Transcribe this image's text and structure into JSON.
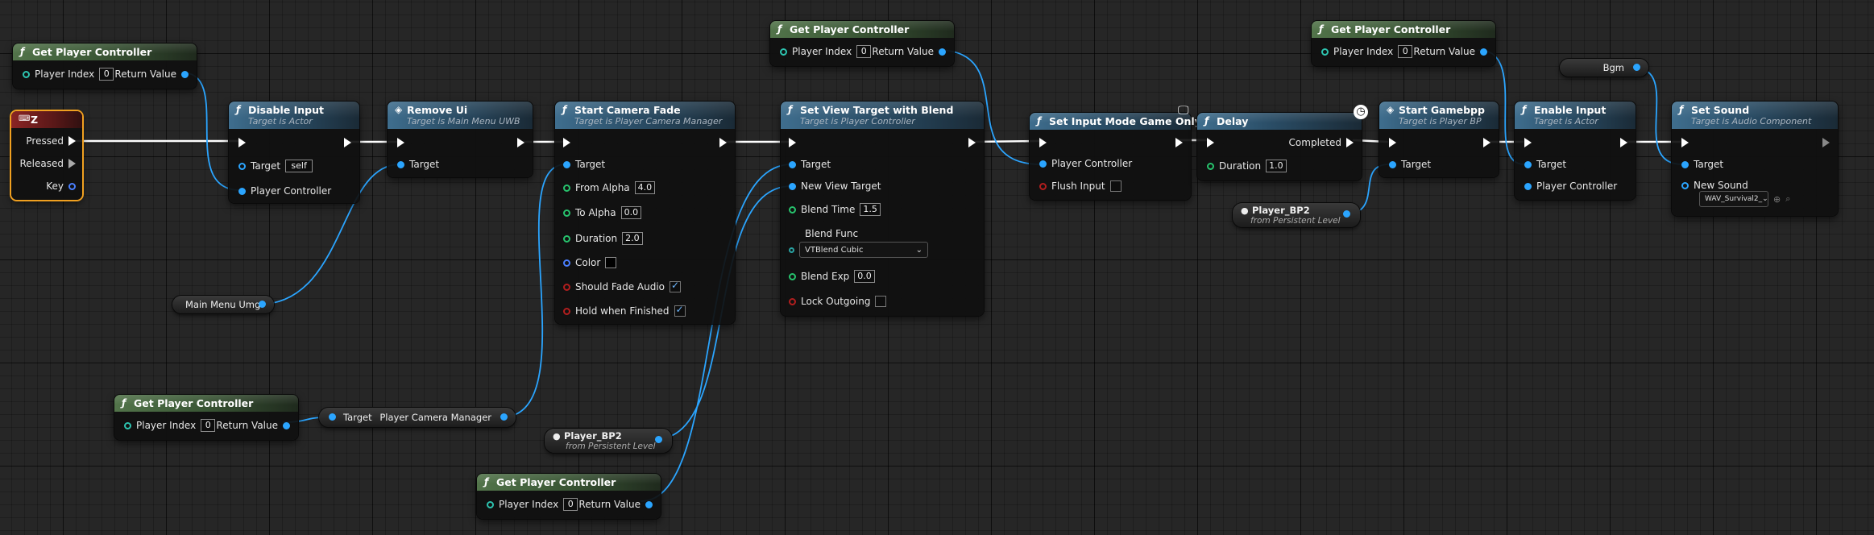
{
  "nodes": {
    "gpc1": {
      "title": "Get Player Controller",
      "player_index_label": "Player Index",
      "player_index": "0",
      "return_label": "Return Value"
    },
    "z_key": {
      "title": "Z",
      "pressed": "Pressed",
      "released": "Released",
      "key": "Key"
    },
    "disable_input": {
      "title": "Disable Input",
      "subtitle": "Target is Actor",
      "target": "Target",
      "target_value": "self",
      "pc": "Player Controller"
    },
    "remove_ui": {
      "title": "Remove Ui",
      "subtitle": "Target is Main Menu UWB",
      "target": "Target"
    },
    "start_fade": {
      "title": "Start Camera Fade",
      "subtitle": "Target is Player Camera Manager",
      "target": "Target",
      "from_alpha": "From Alpha",
      "from_alpha_v": "4.0",
      "to_alpha": "To Alpha",
      "to_alpha_v": "0.0",
      "duration": "Duration",
      "duration_v": "2.0",
      "color": "Color",
      "fade_audio": "Should Fade Audio",
      "hold": "Hold when Finished"
    },
    "gpc2": {
      "title": "Get Player Controller",
      "player_index_label": "Player Index",
      "player_index": "0",
      "return_label": "Return Value"
    },
    "set_view": {
      "title": "Set View Target with Blend",
      "subtitle": "Target is Player Controller",
      "target": "Target",
      "new_view": "New View Target",
      "blend_time": "Blend Time",
      "blend_time_v": "1.5",
      "blend_func": "Blend Func",
      "blend_func_v": "VTBlend Cubic",
      "blend_exp": "Blend Exp",
      "blend_exp_v": "0.0",
      "lock": "Lock Outgoing"
    },
    "input_mode": {
      "title": "Set Input Mode Game Only",
      "pc": "Player Controller",
      "flush": "Flush Input"
    },
    "delay": {
      "title": "Delay",
      "completed": "Completed",
      "duration": "Duration",
      "duration_v": "1.0"
    },
    "gpc3": {
      "title": "Get Player Controller",
      "player_index_label": "Player Index",
      "player_index": "0",
      "return_label": "Return Value"
    },
    "start_gamebpp": {
      "title": "Start Gamebpp",
      "subtitle": "Target is Player BP",
      "target": "Target"
    },
    "enable_input": {
      "title": "Enable Input",
      "subtitle": "Target is Actor",
      "target": "Target",
      "pc": "Player Controller"
    },
    "bgm": {
      "title": "Bgm"
    },
    "set_sound": {
      "title": "Set Sound",
      "subtitle": "Target is Audio Component",
      "target": "Target",
      "new_sound": "New Sound",
      "new_sound_v": "WAV_Survival2_"
    },
    "main_menu_umg": {
      "title": "Main Menu Umg"
    },
    "gpc4": {
      "title": "Get Player Controller",
      "player_index_label": "Player Index",
      "player_index": "0",
      "return_label": "Return Value"
    },
    "pcm": {
      "target": "Target",
      "out": "Player Camera Manager"
    },
    "player_bp2_a": {
      "title": "Player_BP2",
      "subtitle": "from Persistent Level"
    },
    "player_bp2_b": {
      "title": "Player_BP2",
      "subtitle": "from Persistent Level"
    },
    "gpc5": {
      "title": "Get Player Controller",
      "player_index_label": "Player Index",
      "player_index": "0",
      "return_label": "Return Value"
    }
  },
  "colors": {
    "exec": "#ffffff",
    "object_pin": "#2ba5ff",
    "float_pin": "#27c36d",
    "int_pin": "#2dc4b0",
    "bool_pin": "#b21e1e",
    "struct_pin": "#4a7fff",
    "selection": "#f0a020"
  }
}
